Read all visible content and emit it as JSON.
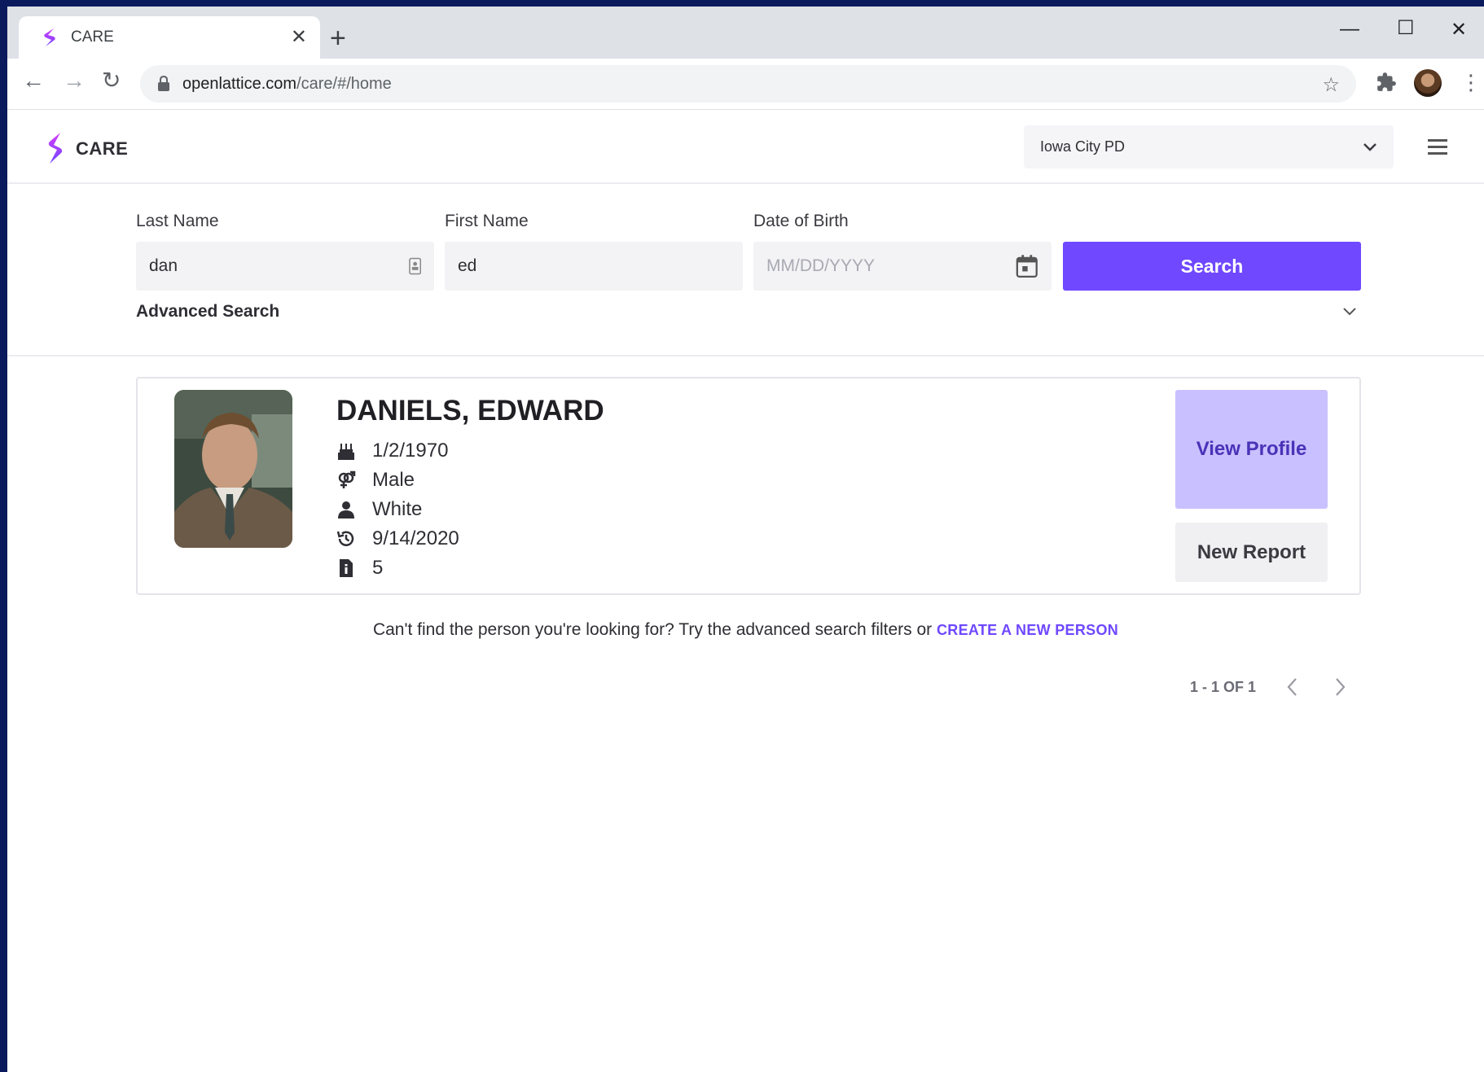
{
  "browser": {
    "tab_title": "CARE",
    "url_host": "openlattice.com",
    "url_path": "/care/#/home"
  },
  "app": {
    "title": "CARE",
    "agency_selected": "Iowa City PD"
  },
  "search": {
    "last_name_label": "Last Name",
    "last_name_value": "dan",
    "first_name_label": "First Name",
    "first_name_value": "ed",
    "dob_label": "Date of Birth",
    "dob_placeholder": "MM/DD/YYYY",
    "search_button": "Search",
    "advanced_label": "Advanced Search"
  },
  "result": {
    "name": "DANIELS, EDWARD",
    "dob": "1/2/1970",
    "sex": "Male",
    "race": "White",
    "last_seen": "9/14/2020",
    "report_count": "5",
    "view_profile": "View Profile",
    "new_report": "New Report"
  },
  "footer": {
    "help_text": "Can't find the person you're looking for? Try the advanced search filters or ",
    "create_link": "CREATE A NEW PERSON",
    "pagination": "1 - 1 OF 1"
  },
  "icons": {
    "birthday": "cake-icon",
    "sex": "venus-mars-icon",
    "race": "user-icon",
    "history": "history-icon",
    "reports": "file-info-icon"
  },
  "colors": {
    "accent": "#6f48ff",
    "view_profile_bg": "#c9c0ff"
  }
}
